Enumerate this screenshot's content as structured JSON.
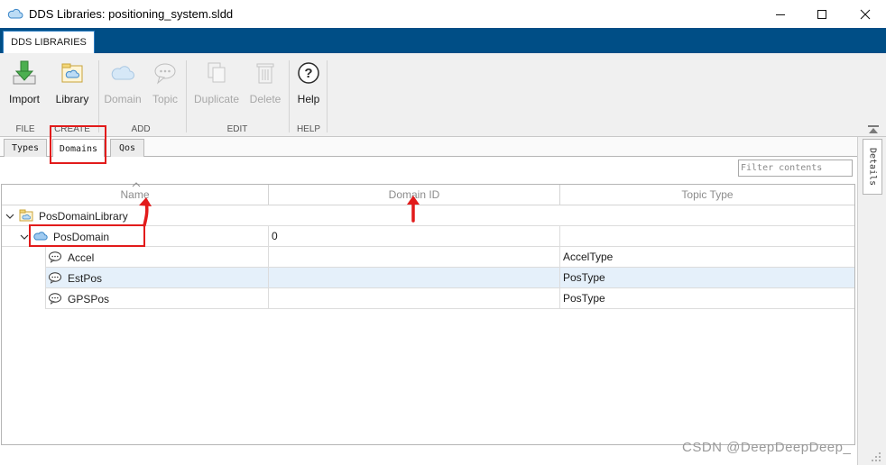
{
  "window": {
    "title": "DDS Libraries: positioning_system.sldd",
    "controls": [
      "minimize",
      "maximize",
      "close"
    ]
  },
  "ribbon": {
    "tab": "DDS LIBRARIES",
    "buttons": {
      "import": "Import",
      "library": "Library",
      "domain": "Domain",
      "topic": "Topic",
      "duplicate": "Duplicate",
      "delete": "Delete",
      "help": "Help"
    },
    "groups": {
      "file": "FILE",
      "create": "CREATE",
      "add": "ADD",
      "edit": "EDIT",
      "help": "HELP"
    }
  },
  "inner_tabs": [
    "Types",
    "Domains",
    "Qos"
  ],
  "active_inner_tab": "Domains",
  "filter": {
    "placeholder": "Filter contents"
  },
  "side_panel": {
    "label": "Details"
  },
  "table": {
    "columns": [
      "Name",
      "Domain ID",
      "Topic Type"
    ],
    "rows": [
      {
        "name": "PosDomainLibrary",
        "domain_id": "",
        "topic_type": "",
        "level": 0,
        "icon": "library-icon",
        "expanded": true
      },
      {
        "name": "PosDomain",
        "domain_id": "0",
        "topic_type": "",
        "level": 1,
        "icon": "domain-cloud-icon",
        "expanded": true
      },
      {
        "name": "Accel",
        "domain_id": "",
        "topic_type": "AccelType",
        "level": 2,
        "icon": "topic-speech-icon"
      },
      {
        "name": "EstPos",
        "domain_id": "",
        "topic_type": "PosType",
        "level": 2,
        "icon": "topic-speech-icon",
        "selected": true
      },
      {
        "name": "GPSPos",
        "domain_id": "",
        "topic_type": "PosType",
        "level": 2,
        "icon": "topic-speech-icon"
      }
    ]
  },
  "watermark": "CSDN @DeepDeepDeep_",
  "colors": {
    "tab_strip": "#004e86",
    "ribbon_bg": "#f0f0f0",
    "selected_row": "#e5f0fa",
    "annotation_red": "#e21b1b"
  }
}
